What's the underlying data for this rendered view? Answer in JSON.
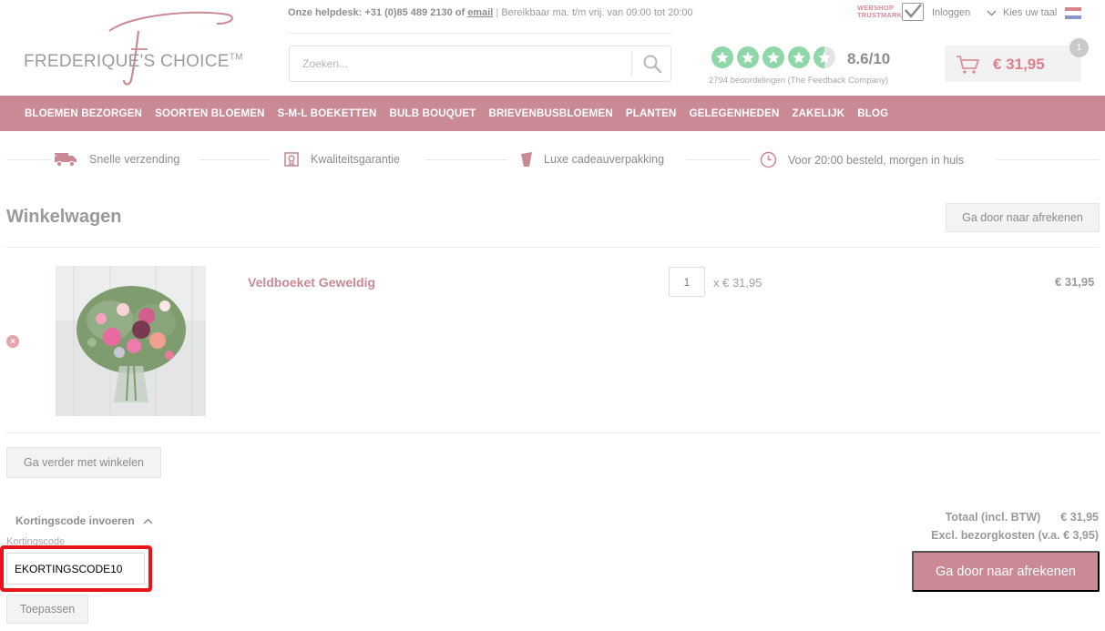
{
  "header": {
    "logo_text": "FREDERIQUE'S CHOICE",
    "logo_tm": "TM",
    "helpdesk": {
      "prefix": "Onze helpdesk: +31 (0)85 489 2130 of",
      "email_link": "email",
      "separator": "|",
      "hours": "Bereikbaar ma. t/m vrij. van 09:00 tot 20:00"
    },
    "trustmark": {
      "line1": "WEBSHOP",
      "line2": "TRUSTMARK"
    },
    "login_label": "Inloggen",
    "language_label": "Kies uw taal",
    "search": {
      "placeholder": "Zoeken...",
      "value": ""
    },
    "rating": {
      "score": "8.6/10",
      "stars": 4.5,
      "reviews_text": "2794 beoordelingen (The Feedback Company)"
    },
    "cart": {
      "total": "€ 31,95",
      "count": "1"
    }
  },
  "nav": {
    "items": [
      "BLOEMEN BEZORGEN",
      "SOORTEN BLOEMEN",
      "S-M-L BOEKETTEN",
      "BULB BOUQUET",
      "BRIEVENBUSBLOEMEN",
      "PLANTEN",
      "GELEGENHEDEN",
      "ZAKELIJK",
      "BLOG"
    ]
  },
  "usps": [
    {
      "icon": "truck-icon",
      "label": "Snelle verzending"
    },
    {
      "icon": "quality-badge-icon",
      "label": "Kwaliteitsgarantie"
    },
    {
      "icon": "gift-wrap-icon",
      "label": "Luxe cadeauverpakking"
    },
    {
      "icon": "clock-icon",
      "label": "Voor 20:00 besteld, morgen in huis"
    }
  ],
  "cart_page": {
    "title": "Winkelwagen",
    "checkout_top_label": "Ga door naar afrekenen",
    "item": {
      "name": "Veldboeket Geweldig",
      "quantity": "1",
      "unit_price": "x € 31,95",
      "line_total": "€ 31,95"
    },
    "continue_shopping_label": "Ga verder met winkelen",
    "coupon": {
      "toggle_label": "Kortingscode invoeren",
      "field_label": "Kortingscode",
      "value": "EKORTINGSCODE10",
      "apply_label": "Toepassen"
    },
    "totals": {
      "total_label": "Totaal (incl. BTW)",
      "total_value": "€ 31,95",
      "shipping_label": "Excl. bezorgkosten (v.a. € 3,95)"
    },
    "checkout_bottom_label": "Ga door naar afrekenen"
  },
  "colors": {
    "brand_pink": "#c98a95",
    "rating_green": "#8fd7a9",
    "highlight_red": "#e8141c"
  }
}
